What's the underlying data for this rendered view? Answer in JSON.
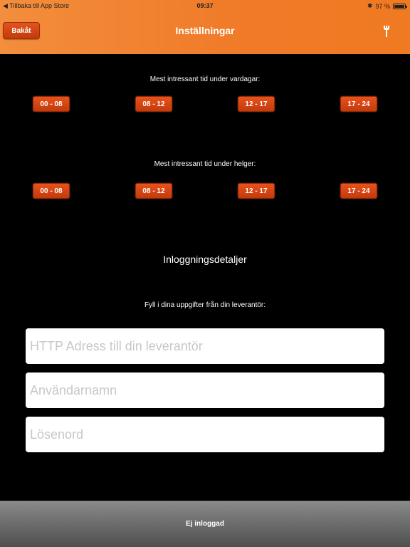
{
  "status_bar": {
    "back_label": "Tillbaka till App Store",
    "time": "09:37",
    "battery": "97 %",
    "battery_level": 0.97
  },
  "nav": {
    "back_label": "Bakåt",
    "title": "Inställningar",
    "tool_icon": "wrench-icon"
  },
  "weekdays": {
    "label": "Mest intressant tid under vardagar:",
    "slots": [
      "00 - 08",
      "08 - 12",
      "12 - 17",
      "17 - 24"
    ]
  },
  "weekends": {
    "label": "Mest intressant tid under helger:",
    "slots": [
      "00 - 08",
      "08 - 12",
      "12 - 17",
      "17 - 24"
    ]
  },
  "login": {
    "title": "Inloggningsdetaljer",
    "instructions": "Fyll i dina uppgifter från din leverantör:",
    "url_placeholder": "HTTP Adress till din leverantör",
    "username_placeholder": "Användarnamn",
    "password_placeholder": "Lösenord"
  },
  "footer": {
    "status": "Ej inloggad"
  },
  "colors": {
    "header": "#f07a28",
    "button": "#d4451a",
    "background": "#000000",
    "footer": "#6e6e6e"
  }
}
